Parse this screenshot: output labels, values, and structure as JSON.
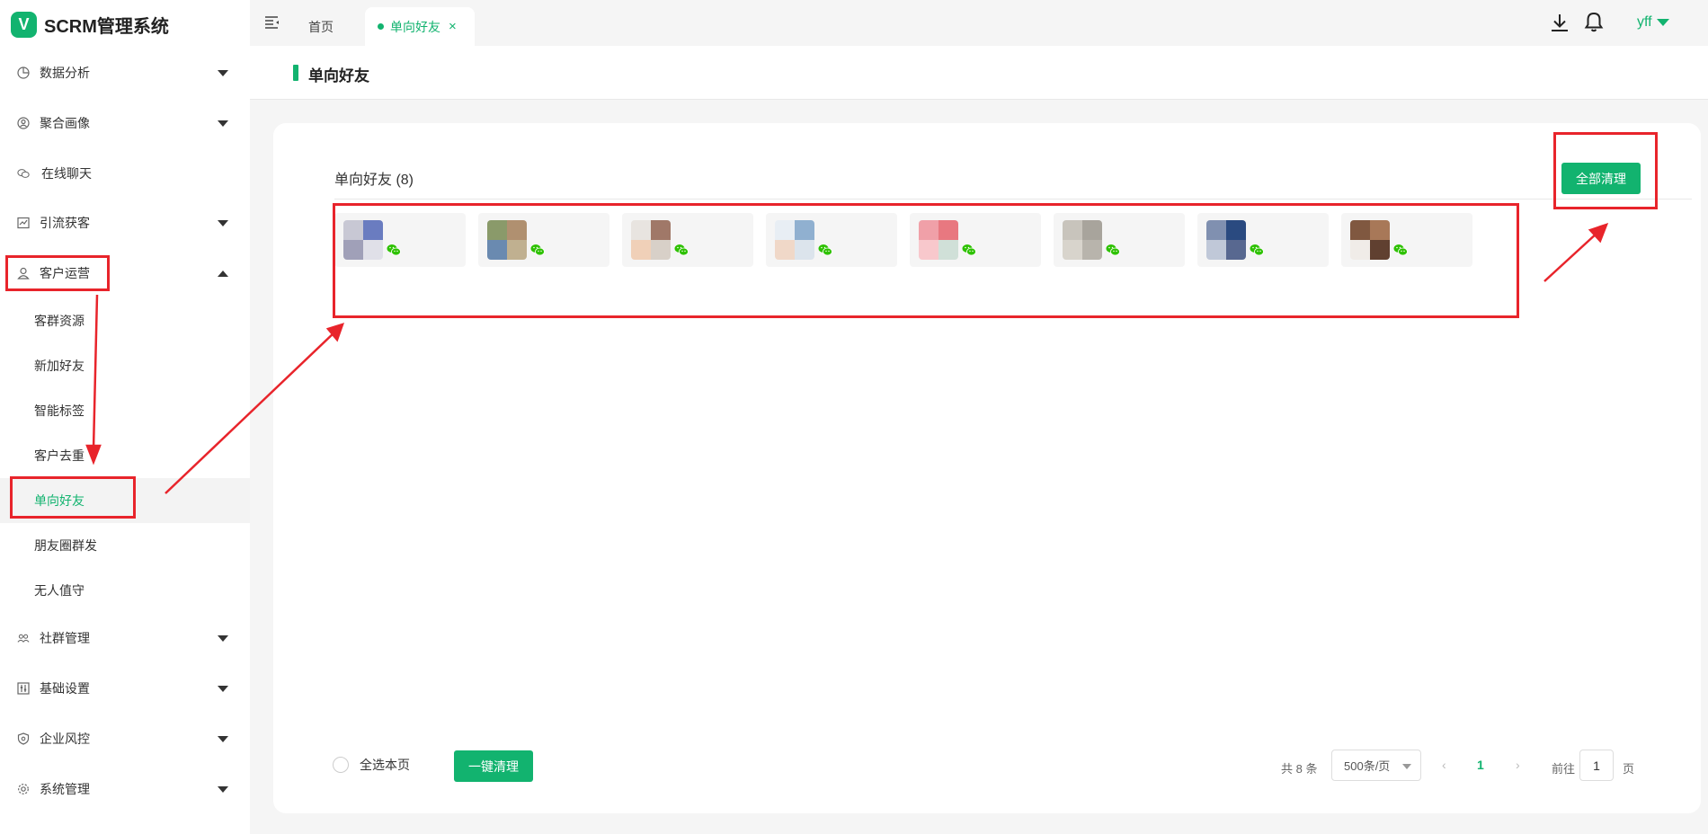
{
  "app": {
    "logo_letter": "V",
    "title": "SCRM管理系统"
  },
  "sidebar": {
    "items": [
      {
        "label": "数据分析",
        "icon": "pie-chart-icon",
        "expandable": true,
        "expanded": false
      },
      {
        "label": "聚合画像",
        "icon": "user-circle-icon",
        "expandable": true,
        "expanded": false
      },
      {
        "label": "在线聊天",
        "icon": "chat-bubbles-icon",
        "expandable": false
      },
      {
        "label": "引流获客",
        "icon": "trend-chart-icon",
        "expandable": true,
        "expanded": false
      },
      {
        "label": "客户运营",
        "icon": "person-icon",
        "expandable": true,
        "expanded": true
      },
      {
        "label": "社群管理",
        "icon": "group-icon",
        "expandable": true,
        "expanded": false
      },
      {
        "label": "基础设置",
        "icon": "sliders-icon",
        "expandable": true,
        "expanded": false
      },
      {
        "label": "企业风控",
        "icon": "shield-icon",
        "expandable": true,
        "expanded": false
      },
      {
        "label": "系统管理",
        "icon": "gear-icon",
        "expandable": true,
        "expanded": false
      }
    ],
    "sub_items": [
      {
        "label": "客群资源",
        "active": false
      },
      {
        "label": "新加好友",
        "active": false
      },
      {
        "label": "智能标签",
        "active": false
      },
      {
        "label": "客户去重",
        "active": false
      },
      {
        "label": "单向好友",
        "active": true
      },
      {
        "label": "朋友圈群发",
        "active": false
      },
      {
        "label": "无人值守",
        "active": false
      }
    ]
  },
  "topbar": {
    "tabs": [
      {
        "label": "首页",
        "active": false
      },
      {
        "label": "单向好友",
        "active": true,
        "closable": true
      }
    ],
    "close_glyph": "×",
    "user": "yff"
  },
  "page": {
    "title": "单向好友"
  },
  "card": {
    "heading": "单向好友 (8)",
    "clear_all_label": "全部清理",
    "friends": [
      {
        "name": "",
        "avatar_colors": [
          "#c8c8d4",
          "#6a7cc0",
          "#a0a0b8",
          "#e0e0e8"
        ]
      },
      {
        "name": "",
        "avatar_colors": [
          "#8a9a6a",
          "#b09070",
          "#6a8ab0",
          "#c0b090"
        ]
      },
      {
        "name": "",
        "avatar_colors": [
          "#e8e4e0",
          "#a07868",
          "#f0d0b8",
          "#d8d0c8"
        ]
      },
      {
        "name": "",
        "avatar_colors": [
          "#e8eef4",
          "#90b0d0",
          "#f0d8c8",
          "#dce4ec"
        ]
      },
      {
        "name": "",
        "avatar_colors": [
          "#f0a0a8",
          "#e87880",
          "#f8c8cc",
          "#d0e0d8"
        ]
      },
      {
        "name": "",
        "avatar_colors": [
          "#c8c4bc",
          "#a8a49c",
          "#d8d4cc",
          "#b8b4ac"
        ]
      },
      {
        "name": "",
        "avatar_colors": [
          "#8090b0",
          "#2a4a80",
          "#c0c8d8",
          "#586890"
        ]
      },
      {
        "name": "",
        "avatar_colors": [
          "#805840",
          "#a87858",
          "#f0ece8",
          "#604030"
        ]
      }
    ],
    "select_all_label": "全选本页",
    "one_key_label": "一键清理",
    "pagination": {
      "total_text": "共 8 条",
      "page_size": "500条/页",
      "prev": "‹",
      "current_page": "1",
      "next": "›",
      "goto_label": "前往",
      "goto_value": "1",
      "goto_suffix": "页"
    }
  },
  "colors": {
    "accent": "#12b36f",
    "annotation": "#e8242b"
  }
}
